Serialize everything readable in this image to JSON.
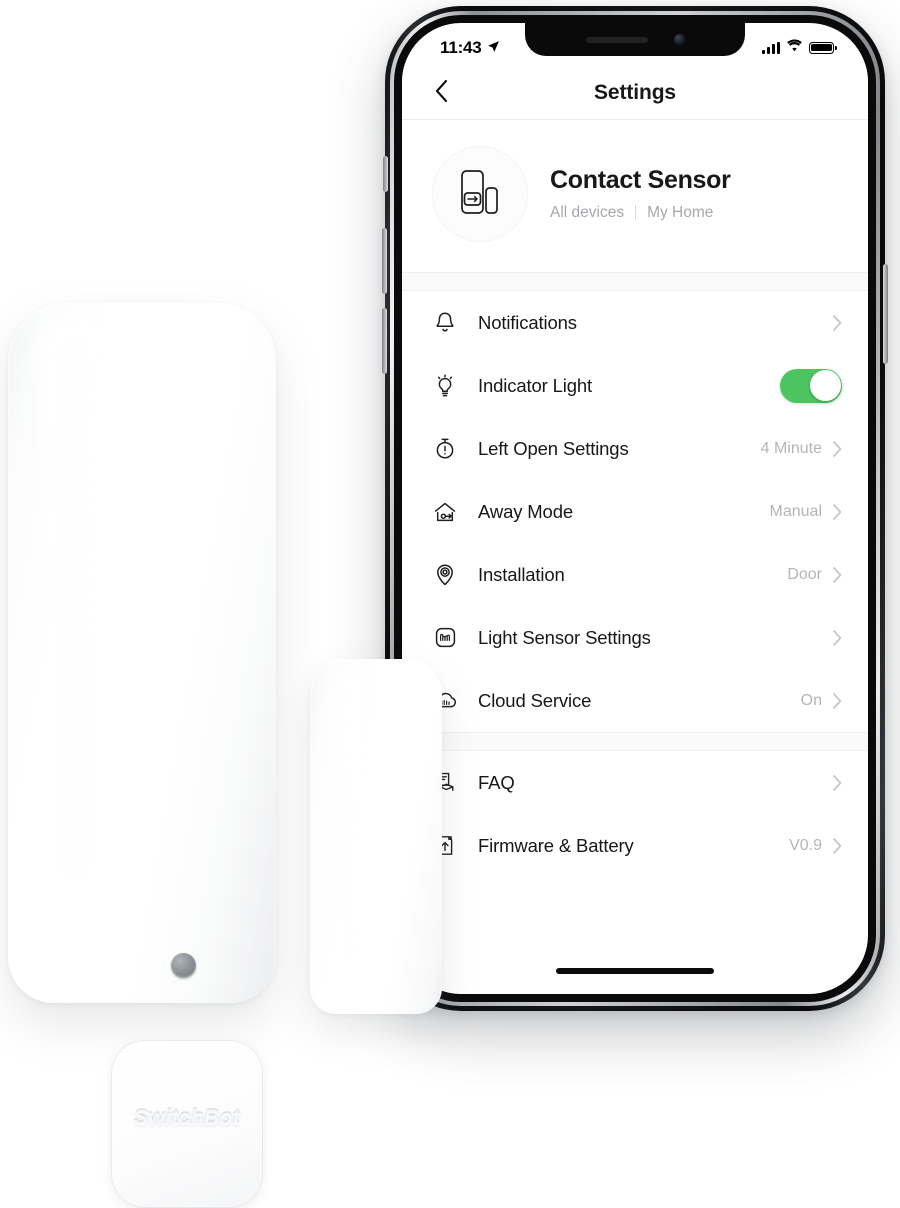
{
  "status_bar": {
    "time": "11:43",
    "location_icon": "location-arrow-icon",
    "signal_icon": "cellular-signal-icon",
    "wifi_icon": "wifi-icon",
    "battery_icon": "battery-full-icon"
  },
  "nav": {
    "back_icon": "chevron-left-icon",
    "title": "Settings"
  },
  "device": {
    "thumb_icon": "contact-sensor-icon",
    "name": "Contact Sensor",
    "group": "All devices",
    "home": "My Home"
  },
  "sections": [
    {
      "rows": [
        {
          "icon": "bell-icon",
          "label": "Notifications",
          "value": "",
          "control": "chevron"
        },
        {
          "icon": "lightbulb-icon",
          "label": "Indicator Light",
          "value": "",
          "control": "toggle",
          "toggle_on": true
        },
        {
          "icon": "timer-icon",
          "label": "Left Open Settings",
          "value": "4 Minute",
          "control": "chevron"
        },
        {
          "icon": "house-away-icon",
          "label": "Away Mode",
          "value": "Manual",
          "control": "chevron"
        },
        {
          "icon": "location-pin-icon",
          "label": "Installation",
          "value": "Door",
          "control": "chevron"
        },
        {
          "icon": "light-sensor-icon",
          "label": "Light Sensor Settings",
          "value": "",
          "control": "chevron"
        },
        {
          "icon": "cloud-icon",
          "label": "Cloud Service",
          "value": "On",
          "control": "chevron"
        }
      ]
    },
    {
      "rows": [
        {
          "icon": "faq-icon",
          "label": "FAQ",
          "value": "",
          "control": "chevron"
        },
        {
          "icon": "firmware-icon",
          "label": "Firmware & Battery",
          "value": "V0.9",
          "control": "chevron"
        }
      ]
    }
  ],
  "product": {
    "brand": "SwitchBot",
    "body_name": "contact-sensor-body",
    "magnet_name": "contact-sensor-magnet"
  },
  "colors": {
    "toggle_on": "#4CC45F",
    "text_primary": "#16181a",
    "text_muted": "#b3b5b9",
    "background": "#ffffff"
  }
}
